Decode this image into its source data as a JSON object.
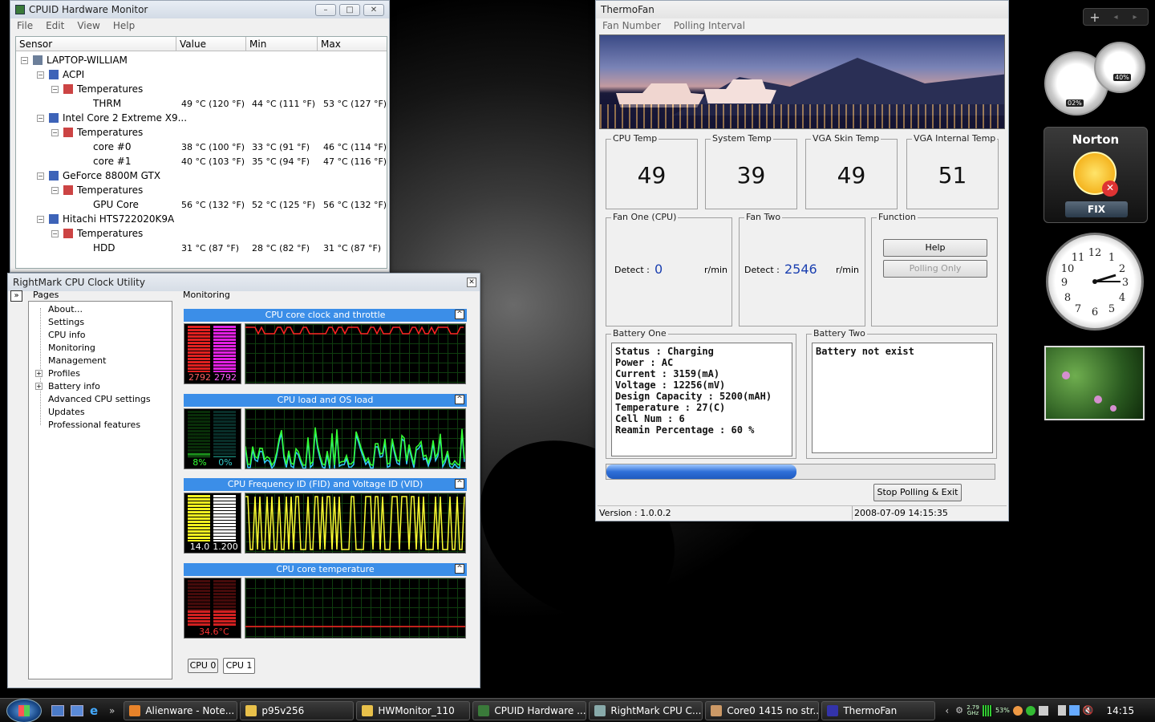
{
  "cpuid": {
    "title": "CPUID Hardware Monitor",
    "menu": [
      "File",
      "Edit",
      "View",
      "Help"
    ],
    "columns": [
      "Sensor",
      "Value",
      "Min",
      "Max"
    ],
    "tree": [
      {
        "label": "LAPTOP-WILLIAM",
        "level": 0
      },
      {
        "label": "ACPI",
        "level": 1
      },
      {
        "label": "Temperatures",
        "level": 2
      },
      {
        "label": "THRM",
        "level": 3,
        "value": "49 °C  (120 °F)",
        "min": "44 °C  (111 °F)",
        "max": "53 °C  (127 °F)"
      },
      {
        "label": "Intel Core 2 Extreme X9...",
        "level": 1
      },
      {
        "label": "Temperatures",
        "level": 2
      },
      {
        "label": "core #0",
        "level": 3,
        "value": "38 °C  (100 °F)",
        "min": "33 °C  (91 °F)",
        "max": "46 °C  (114 °F)"
      },
      {
        "label": "core #1",
        "level": 3,
        "value": "40 °C  (103 °F)",
        "min": "35 °C  (94 °F)",
        "max": "47 °C  (116 °F)"
      },
      {
        "label": "GeForce 8800M GTX",
        "level": 1
      },
      {
        "label": "Temperatures",
        "level": 2
      },
      {
        "label": "GPU Core",
        "level": 3,
        "value": "56 °C  (132 °F)",
        "min": "52 °C  (125 °F)",
        "max": "56 °C  (132 °F)"
      },
      {
        "label": "Hitachi HTS722020K9A",
        "level": 1
      },
      {
        "label": "Temperatures",
        "level": 2
      },
      {
        "label": "HDD",
        "level": 3,
        "value": "31 °C  (87 °F)",
        "min": "28 °C  (82 °F)",
        "max": "31 °C  (87 °F)"
      }
    ]
  },
  "rightmark": {
    "title": "RightMark CPU Clock Utility",
    "pages_label": "Pages",
    "monitoring_label": "Monitoring",
    "pages": [
      "About...",
      "Settings",
      "CPU info",
      "Monitoring",
      "Management",
      "Profiles",
      "Battery info",
      "Advanced CPU settings",
      "Updates",
      "Professional features"
    ],
    "panels": [
      {
        "title": "CPU core clock and throttle",
        "labels": [
          "2792",
          "2792"
        ]
      },
      {
        "title": "CPU load and OS load",
        "labels": [
          "8%",
          "0%"
        ]
      },
      {
        "title": "CPU Frequency ID (FID) and Voltage ID (VID)",
        "labels": [
          "14.0",
          "1.200"
        ]
      },
      {
        "title": "CPU core temperature",
        "labels": [
          "34.6°C"
        ]
      }
    ],
    "cpu_tabs": [
      "CPU 0",
      "CPU 1"
    ]
  },
  "thermofan": {
    "title": "ThermoFan",
    "menu": [
      "Fan Number",
      "Polling Interval"
    ],
    "temps": [
      {
        "label": "CPU Temp",
        "value": "49"
      },
      {
        "label": "System Temp",
        "value": "39"
      },
      {
        "label": "VGA Skin Temp",
        "value": "49"
      },
      {
        "label": "VGA Internal Temp",
        "value": "51"
      }
    ],
    "fan_one": {
      "label": "Fan One (CPU)",
      "detect_label": "Detect :",
      "value": "0",
      "unit": "r/min"
    },
    "fan_two": {
      "label": "Fan Two",
      "detect_label": "Detect :",
      "value": "2546",
      "unit": "r/min"
    },
    "function": {
      "label": "Function",
      "help": "Help",
      "polling_only": "Polling Only"
    },
    "battery_one": {
      "label": "Battery One",
      "text": "Status : Charging\nPower : AC\nCurrent : 3159(mA)\nVoltage : 12256(mV)\nDesign Capacity : 5200(mAH)\nTemperature : 27(C)\nCell Num : 6\nReamin Percentage : 60 %"
    },
    "battery_two": {
      "label": "Battery Two",
      "text": "Battery not exist"
    },
    "progress": 0.6,
    "stop_button": "Stop Polling & Exit",
    "version": "Version : 1.0.0.2",
    "datetime": "2008-07-09 14:15:35"
  },
  "gadgets": {
    "meter_left": "02%",
    "meter_right": "40%",
    "norton": "Norton",
    "norton_fix": "FIX"
  },
  "taskbar": {
    "tasks": [
      "Alienware - Note...",
      "p95v256",
      "HWMonitor_110",
      "CPUID Hardware ...",
      "RightMark CPU C...",
      "Core0 1415 no str...",
      "ThermoFan"
    ],
    "tray_cpu": "2.79 GHz",
    "tray_pct": "53%",
    "clock": "14:15"
  },
  "colors": {
    "accent": "#3b8ee8",
    "taskbar": "#1a1a1a"
  }
}
